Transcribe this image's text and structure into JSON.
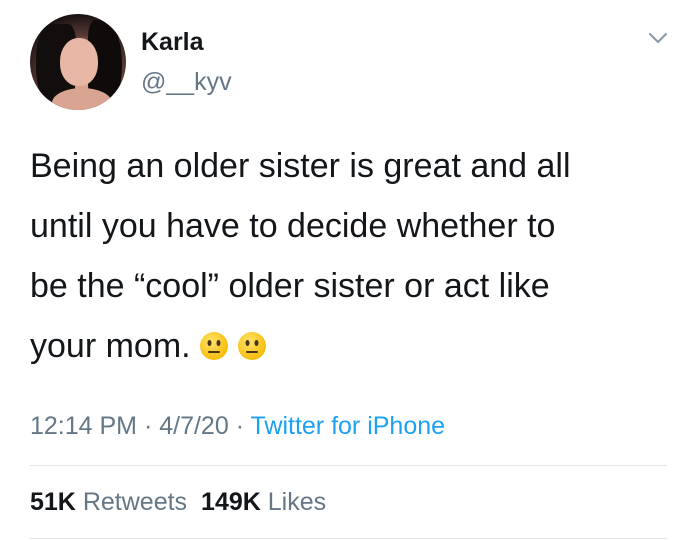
{
  "user": {
    "display_name": "Karla",
    "handle": "@__kyv"
  },
  "tweet": {
    "lines": [
      "Being an older sister is great and all",
      "until you have to decide whether to",
      "be the “cool” older sister or act like",
      "your mom."
    ],
    "emojis": [
      "neutral-face-emoji",
      "neutral-face-emoji"
    ]
  },
  "meta": {
    "time": "12:14 PM",
    "sep1": " · ",
    "date": "4/7/20",
    "sep2": " · ",
    "source": "Twitter for iPhone"
  },
  "stats": {
    "retweets_count": "51K",
    "retweets_label": "Retweets",
    "likes_count": "149K",
    "likes_label": "Likes"
  },
  "colors": {
    "text": "#14171a",
    "secondary": "#657786",
    "link": "#1da1f2",
    "divider": "#e1e8ed"
  },
  "icons": {
    "menu": "chevron-down-icon"
  }
}
